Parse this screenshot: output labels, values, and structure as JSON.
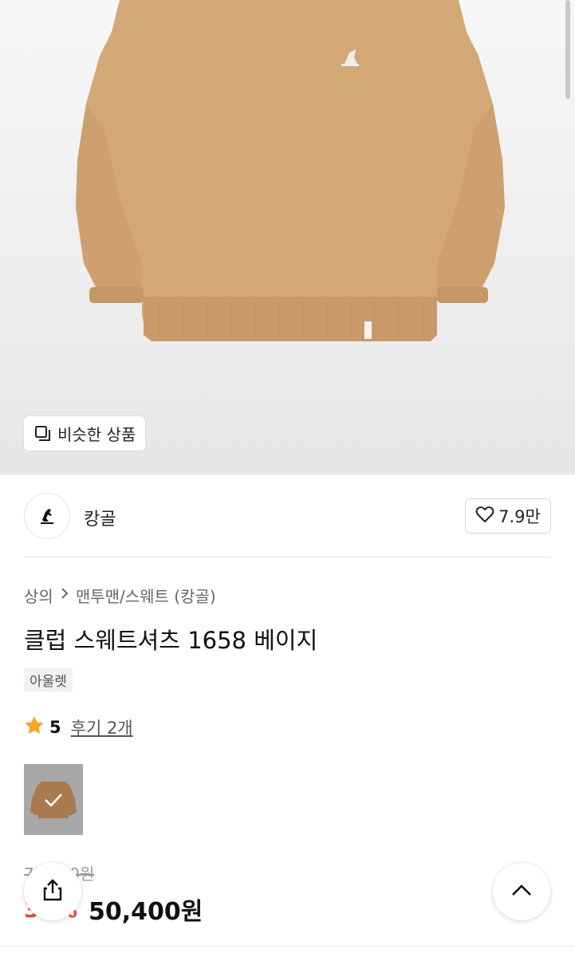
{
  "product_image": {
    "similar_button_label": "비슷한 상품",
    "icon": "copy-square-icon"
  },
  "brand": {
    "name": "캉골",
    "logo": "kangol-logo",
    "like_count": "7.9만",
    "like_icon": "heart-outline-icon"
  },
  "breadcrumb": {
    "category": "상의",
    "subcategory": "맨투맨/스웨트 (캉골)"
  },
  "product": {
    "title": "클럽 스웨트셔츠 1658 베이지",
    "badge": "아울렛",
    "rating": "5",
    "reviews_label": "후기 2개",
    "original_price": "72,000원",
    "discount": "30%",
    "sale_price": "50,400원"
  },
  "colors": {
    "sweatshirt": "#d4a776",
    "discount": "#f04a3a",
    "star": "#f5a623"
  },
  "buttons": {
    "share_icon": "share-icon",
    "top_icon": "chevron-up-icon"
  }
}
